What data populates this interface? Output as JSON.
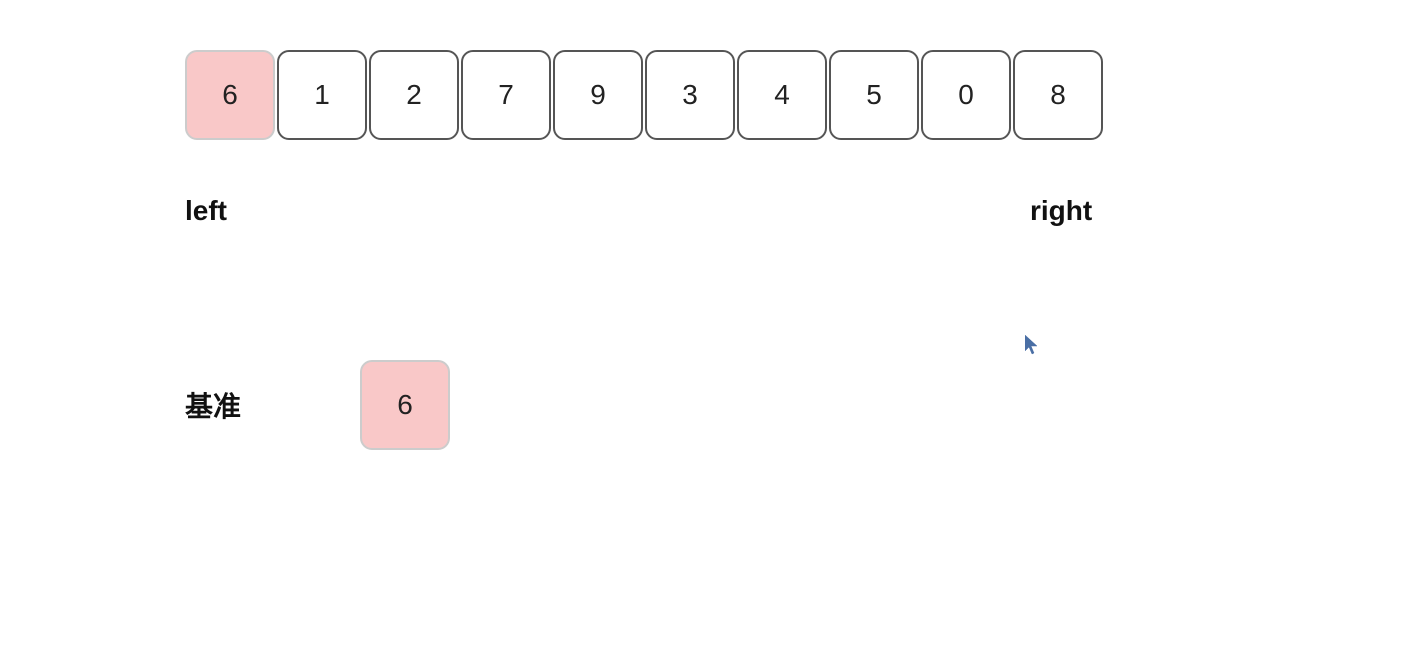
{
  "array": {
    "cells": [
      {
        "value": "6",
        "highlighted": true
      },
      {
        "value": "1",
        "highlighted": false
      },
      {
        "value": "2",
        "highlighted": false
      },
      {
        "value": "7",
        "highlighted": false
      },
      {
        "value": "9",
        "highlighted": false
      },
      {
        "value": "3",
        "highlighted": false
      },
      {
        "value": "4",
        "highlighted": false
      },
      {
        "value": "5",
        "highlighted": false
      },
      {
        "value": "0",
        "highlighted": false
      },
      {
        "value": "8",
        "highlighted": false
      }
    ]
  },
  "labels": {
    "left": "left",
    "right": "right",
    "jizun": "基准"
  },
  "pivot": {
    "value": "6"
  }
}
